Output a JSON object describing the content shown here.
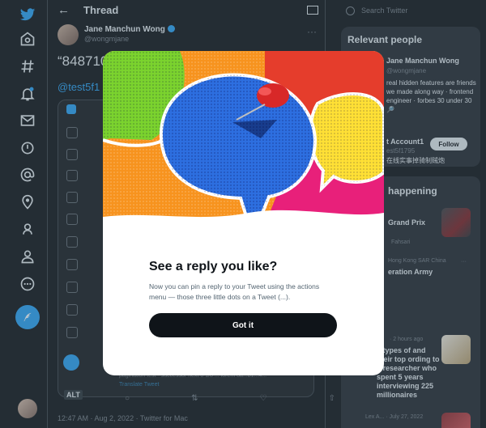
{
  "header": {
    "title": "Thread"
  },
  "tweet": {
    "author_name": "Jane Manchun Wong",
    "author_handle": "@wongmjane",
    "text": "“848710",
    "mention": "@test5f1",
    "timestamp": "12:47 AM · Aug 2, 2022 · Twitter for Mac",
    "alt_label": "ALT",
    "embed_caption": "pagination test - successor next 0 1/8 ... lorem 8a...b1...4...",
    "embed_link": "Translate Tweet"
  },
  "search": {
    "placeholder": "Search Twitter"
  },
  "relevant_people": {
    "title": "Relevant people",
    "person1_name": "Jane Manchun Wong",
    "person1_handle": "@wongmjane",
    "person1_bio": "real hidden features are friends we made along way · frontend engineer · forbes 30 under 30 🔎",
    "person2_name": "t Account1",
    "person2_handle": "est5f1795",
    "person2_bio": "在线实事掉骑制贼炮",
    "follow_label": "Follow"
  },
  "trends": {
    "title": "happening",
    "items": [
      {
        "meta": "",
        "text": "Grand Prix",
        "sub": "Fahsari"
      },
      {
        "meta": "Hong Kong SAR China",
        "text": "eration Army",
        "sub": ""
      },
      {
        "meta": "· 2 hours ago",
        "text": "4 types of and their top ording to a researcher who spent 5 years interviewing 225 millionaires",
        "sub": ""
      },
      {
        "meta": "Lex A... · July 27, 2022",
        "text": "",
        "sub": ""
      }
    ]
  },
  "modal": {
    "title": "See a reply you like?",
    "description": "Now you can pin a reply to your Tweet using the actions menu — those three little dots on a Tweet (...).",
    "button_label": "Got it"
  },
  "colors": {
    "accent": "#1d9bf0",
    "background": "#000000",
    "modal_bg": "#ffffff",
    "button_bg": "#0f1419"
  }
}
